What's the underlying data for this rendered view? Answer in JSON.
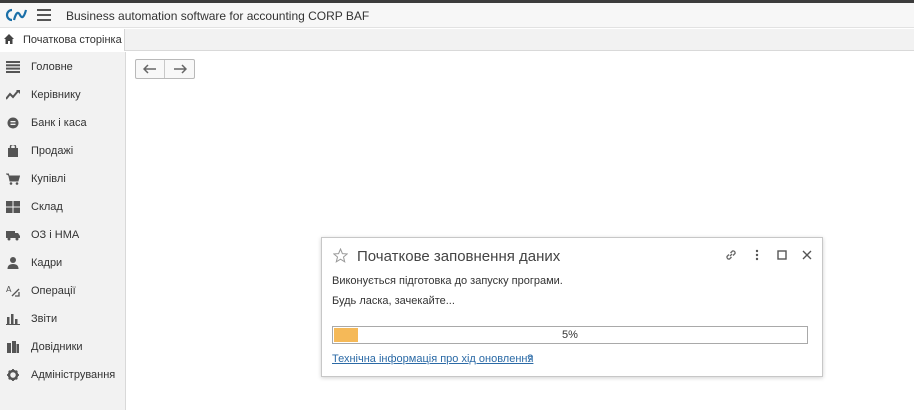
{
  "app": {
    "title": "Business automation software for accounting CORP BAF",
    "accent_color": "#1a6fa8"
  },
  "tabs": {
    "home_label": "Початкова сторінка"
  },
  "sidebar": {
    "items": [
      {
        "label": "Головне",
        "icon": "list-icon"
      },
      {
        "label": "Керівнику",
        "icon": "trend-icon"
      },
      {
        "label": "Банк і каса",
        "icon": "currency-icon"
      },
      {
        "label": "Продажі",
        "icon": "bag-icon"
      },
      {
        "label": "Купівлі",
        "icon": "cart-icon"
      },
      {
        "label": "Склад",
        "icon": "warehouse-icon"
      },
      {
        "label": "ОЗ і НМА",
        "icon": "truck-icon"
      },
      {
        "label": "Кадри",
        "icon": "person-icon"
      },
      {
        "label": "Операції",
        "icon": "operations-icon"
      },
      {
        "label": "Звіти",
        "icon": "bar-chart-icon"
      },
      {
        "label": "Довідники",
        "icon": "books-icon"
      },
      {
        "label": "Адміністрування",
        "icon": "gear-icon"
      }
    ]
  },
  "dialog": {
    "title": "Початкове заповнення даних",
    "message1": "Виконується підготовка до запуску програми.",
    "message2": "Будь ласка, зачекайте...",
    "progress_text": "5%",
    "progress_value": 0.05,
    "progress_color": "#f5b958",
    "link_text": "Технічна інформація про хід оновлення",
    "help_text": "?"
  }
}
